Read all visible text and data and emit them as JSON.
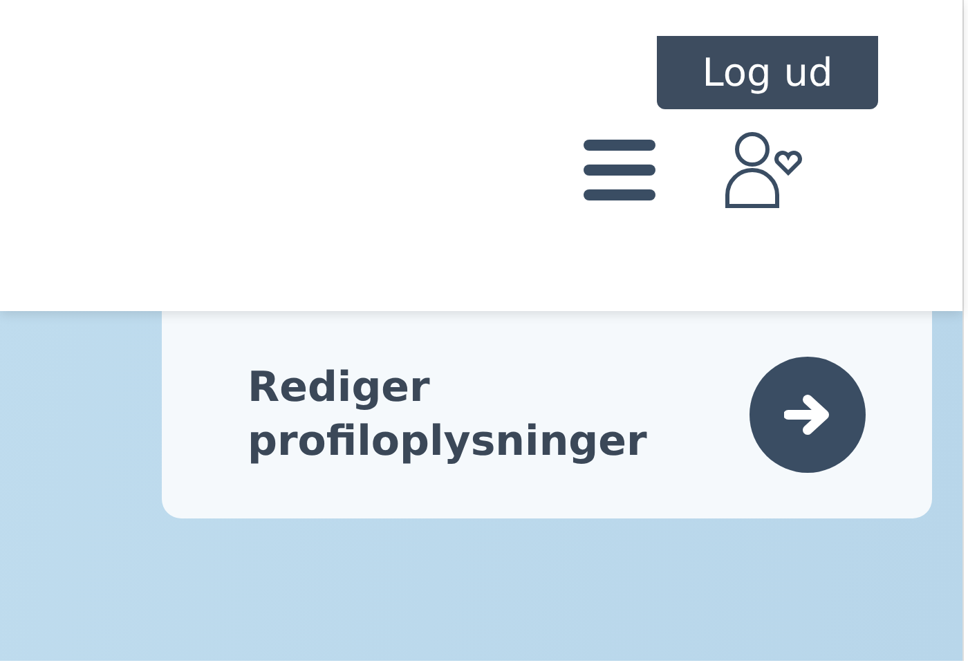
{
  "header": {
    "logout_button": {
      "label": "Log ud"
    }
  },
  "card": {
    "title": "Rediger profiloplysninger"
  }
}
